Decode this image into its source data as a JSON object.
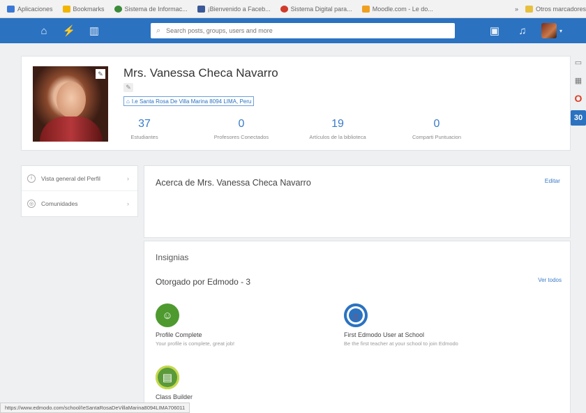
{
  "bookmarks": [
    {
      "label": "Aplicaciones",
      "color": "#3b78d6"
    },
    {
      "label": "Bookmarks",
      "color": "#f2b600"
    },
    {
      "label": "Sistema de Informac...",
      "color": "#3a8b3a"
    },
    {
      "label": "¡Bienvenido a Faceb...",
      "color": "#3b5998"
    },
    {
      "label": "Sistema Digital para...",
      "color": "#d13a2a"
    },
    {
      "label": "Moodle.com - Le do...",
      "color": "#f0a020"
    }
  ],
  "bookmarks_other": "Otros marcadores",
  "nav": {
    "icons": [
      "home-icon",
      "activity-icon",
      "library-icon"
    ],
    "search_placeholder": "Search posts, groups, users and more",
    "right_icons": [
      "backpack-icon",
      "bell-icon"
    ]
  },
  "profile": {
    "name": "Mrs. Vanessa Checa Navarro",
    "school": "I.e Santa Rosa De Villa Marina 8094 LIMA, Peru",
    "stats": [
      {
        "value": "37",
        "label": "Estudiantes"
      },
      {
        "value": "0",
        "label": "Profesores Conectados"
      },
      {
        "value": "19",
        "label": "Artículos de la biblioteca"
      },
      {
        "value": "0",
        "label": "Comparti Puntuacion"
      }
    ]
  },
  "sidebar": {
    "items": [
      {
        "label": "Vista general del Perfil"
      },
      {
        "label": "Comunidades"
      }
    ]
  },
  "about": {
    "title": "Acerca de Mrs. Vanessa Checa Navarro",
    "edit": "Editar"
  },
  "badges": {
    "title": "Insignias",
    "subtitle": "Otorgado por Edmodo - 3",
    "see_all": "Ver todos",
    "items": [
      {
        "name": "Profile Complete",
        "desc": "Your profile is complete, great job!",
        "color": "#4e9a2f"
      },
      {
        "name": "First Edmodo User at School",
        "desc": "Be the first teacher at your school to join Edmodo",
        "color": "#2b72c1"
      },
      {
        "name": "Class Builder",
        "desc": "",
        "color": "#5a9a3a"
      }
    ]
  },
  "status_url": "https://www.edmodo.com/school/IeSantaRosaDeVillaMarina8094LIMA706011"
}
